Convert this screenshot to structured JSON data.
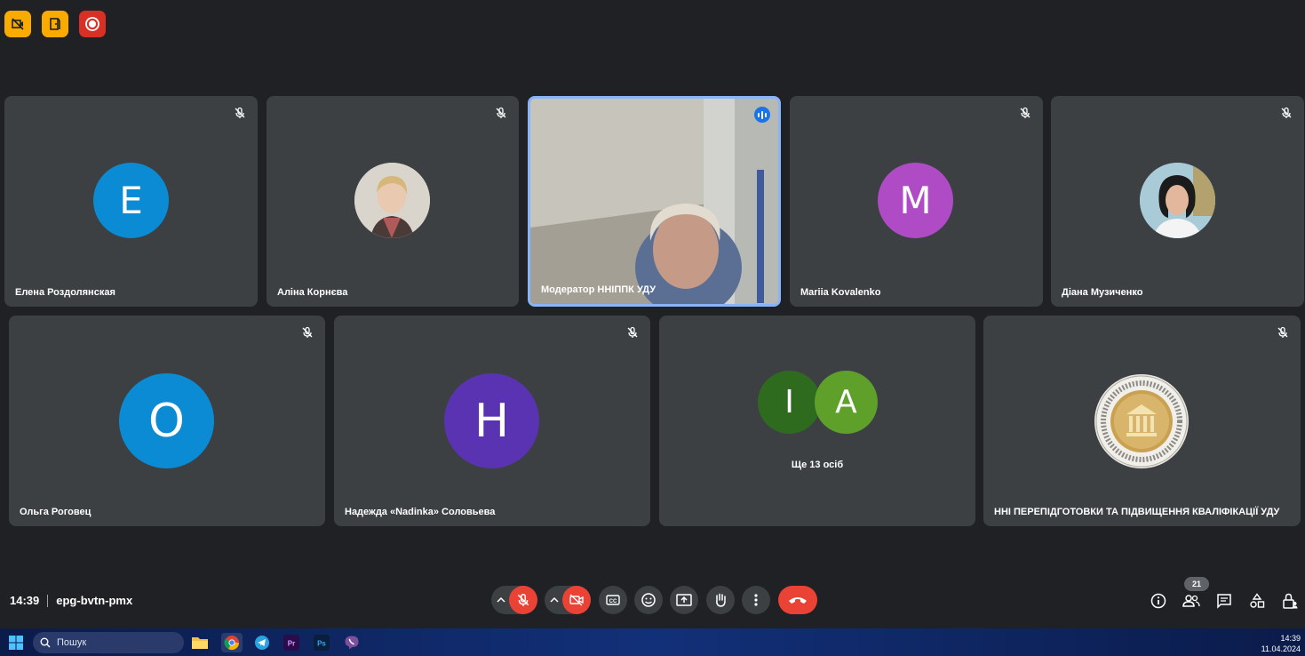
{
  "top_badges": [
    {
      "name": "no-camera-badge-icon",
      "color": "#f9ab00"
    },
    {
      "name": "door-badge-icon",
      "color": "#f9ab00"
    },
    {
      "name": "record-badge-icon",
      "color": "#d93025"
    }
  ],
  "participants": {
    "row1": [
      {
        "name": "Елена Роздолянская",
        "avatar_letter": "E",
        "avatar_color": "#0b8bd4",
        "muted": true
      },
      {
        "name": "Аліна Корнєва",
        "avatar_type": "photo",
        "muted": true
      },
      {
        "name": "Модератор ННІППК УДУ",
        "avatar_type": "video",
        "speaking": true
      },
      {
        "name": "Mariia Kovalenko",
        "avatar_letter": "M",
        "avatar_color": "#b04bc6",
        "muted": true
      },
      {
        "name": "Діана Музиченко",
        "avatar_type": "photo",
        "muted": true
      }
    ],
    "row2": [
      {
        "name": "Ольга Роговец",
        "avatar_letter": "O",
        "avatar_color": "#0b8bd4",
        "muted": true
      },
      {
        "name": "Надежда «Nadinka» Соловьева",
        "avatar_letter": "H",
        "avatar_color": "#5a33b3",
        "muted": true
      },
      {
        "group_letters": [
          "I",
          "A"
        ],
        "group_colors": [
          "#2e6b1f",
          "#5ea02a"
        ],
        "more_label": "Ще 13 осіб"
      },
      {
        "name": "ННІ ПЕРЕПІДГОТОВКИ ТА ПІДВИЩЕННЯ КВАЛІФІКАЦІЇ УДУ",
        "avatar_type": "logo",
        "muted": true
      }
    ]
  },
  "meeting": {
    "time": "14:39",
    "code": "epg-bvtn-pmx"
  },
  "controls": {
    "participant_count": "21"
  },
  "taskbar": {
    "search_placeholder": "Пошук",
    "clock_time": "14:39",
    "clock_date": "11.04.2024"
  },
  "colors": {
    "background": "#202124",
    "tile": "#3c4043",
    "end_call": "#ea4335",
    "active_border": "#8ab4f8"
  }
}
